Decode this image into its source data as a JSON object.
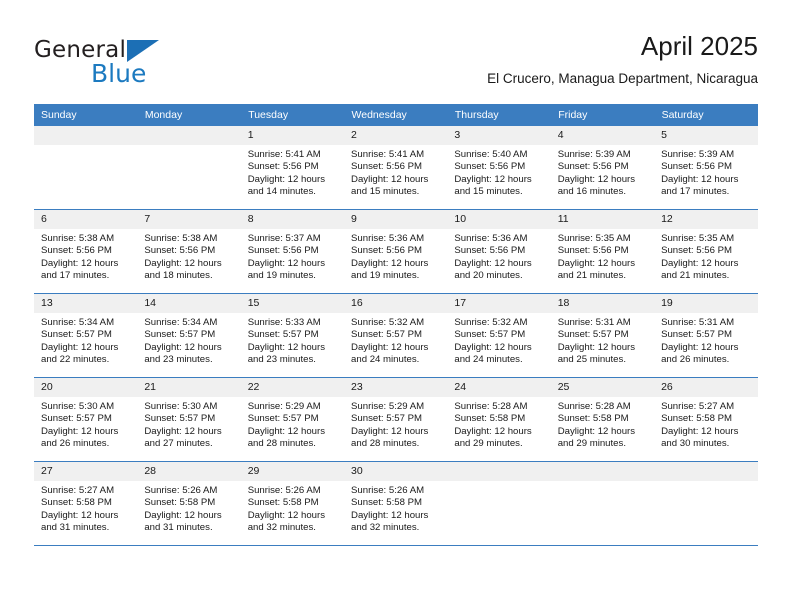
{
  "logo": {
    "word_top": "General",
    "word_bottom": "Blue",
    "triangle_color": "#1c6fb5",
    "blue_text_color": "#1c7ac0"
  },
  "header": {
    "month_title": "April 2025",
    "location": "El Crucero, Managua Department, Nicaragua"
  },
  "theme": {
    "header_blue": "#3b7dc0",
    "daynum_gray": "#f0f0f0"
  },
  "calendar": {
    "weekday_headers": [
      "Sunday",
      "Monday",
      "Tuesday",
      "Wednesday",
      "Thursday",
      "Friday",
      "Saturday"
    ],
    "weeks": [
      [
        {
          "day": "",
          "sunrise": "",
          "sunset": "",
          "daylight_line1": "",
          "daylight_line2": "",
          "empty": true
        },
        {
          "day": "",
          "sunrise": "",
          "sunset": "",
          "daylight_line1": "",
          "daylight_line2": "",
          "empty": true
        },
        {
          "day": "1",
          "sunrise": "Sunrise: 5:41 AM",
          "sunset": "Sunset: 5:56 PM",
          "daylight_line1": "Daylight: 12 hours",
          "daylight_line2": "and 14 minutes.",
          "empty": false
        },
        {
          "day": "2",
          "sunrise": "Sunrise: 5:41 AM",
          "sunset": "Sunset: 5:56 PM",
          "daylight_line1": "Daylight: 12 hours",
          "daylight_line2": "and 15 minutes.",
          "empty": false
        },
        {
          "day": "3",
          "sunrise": "Sunrise: 5:40 AM",
          "sunset": "Sunset: 5:56 PM",
          "daylight_line1": "Daylight: 12 hours",
          "daylight_line2": "and 15 minutes.",
          "empty": false
        },
        {
          "day": "4",
          "sunrise": "Sunrise: 5:39 AM",
          "sunset": "Sunset: 5:56 PM",
          "daylight_line1": "Daylight: 12 hours",
          "daylight_line2": "and 16 minutes.",
          "empty": false
        },
        {
          "day": "5",
          "sunrise": "Sunrise: 5:39 AM",
          "sunset": "Sunset: 5:56 PM",
          "daylight_line1": "Daylight: 12 hours",
          "daylight_line2": "and 17 minutes.",
          "empty": false
        }
      ],
      [
        {
          "day": "6",
          "sunrise": "Sunrise: 5:38 AM",
          "sunset": "Sunset: 5:56 PM",
          "daylight_line1": "Daylight: 12 hours",
          "daylight_line2": "and 17 minutes.",
          "empty": false
        },
        {
          "day": "7",
          "sunrise": "Sunrise: 5:38 AM",
          "sunset": "Sunset: 5:56 PM",
          "daylight_line1": "Daylight: 12 hours",
          "daylight_line2": "and 18 minutes.",
          "empty": false
        },
        {
          "day": "8",
          "sunrise": "Sunrise: 5:37 AM",
          "sunset": "Sunset: 5:56 PM",
          "daylight_line1": "Daylight: 12 hours",
          "daylight_line2": "and 19 minutes.",
          "empty": false
        },
        {
          "day": "9",
          "sunrise": "Sunrise: 5:36 AM",
          "sunset": "Sunset: 5:56 PM",
          "daylight_line1": "Daylight: 12 hours",
          "daylight_line2": "and 19 minutes.",
          "empty": false
        },
        {
          "day": "10",
          "sunrise": "Sunrise: 5:36 AM",
          "sunset": "Sunset: 5:56 PM",
          "daylight_line1": "Daylight: 12 hours",
          "daylight_line2": "and 20 minutes.",
          "empty": false
        },
        {
          "day": "11",
          "sunrise": "Sunrise: 5:35 AM",
          "sunset": "Sunset: 5:56 PM",
          "daylight_line1": "Daylight: 12 hours",
          "daylight_line2": "and 21 minutes.",
          "empty": false
        },
        {
          "day": "12",
          "sunrise": "Sunrise: 5:35 AM",
          "sunset": "Sunset: 5:56 PM",
          "daylight_line1": "Daylight: 12 hours",
          "daylight_line2": "and 21 minutes.",
          "empty": false
        }
      ],
      [
        {
          "day": "13",
          "sunrise": "Sunrise: 5:34 AM",
          "sunset": "Sunset: 5:57 PM",
          "daylight_line1": "Daylight: 12 hours",
          "daylight_line2": "and 22 minutes.",
          "empty": false
        },
        {
          "day": "14",
          "sunrise": "Sunrise: 5:34 AM",
          "sunset": "Sunset: 5:57 PM",
          "daylight_line1": "Daylight: 12 hours",
          "daylight_line2": "and 23 minutes.",
          "empty": false
        },
        {
          "day": "15",
          "sunrise": "Sunrise: 5:33 AM",
          "sunset": "Sunset: 5:57 PM",
          "daylight_line1": "Daylight: 12 hours",
          "daylight_line2": "and 23 minutes.",
          "empty": false
        },
        {
          "day": "16",
          "sunrise": "Sunrise: 5:32 AM",
          "sunset": "Sunset: 5:57 PM",
          "daylight_line1": "Daylight: 12 hours",
          "daylight_line2": "and 24 minutes.",
          "empty": false
        },
        {
          "day": "17",
          "sunrise": "Sunrise: 5:32 AM",
          "sunset": "Sunset: 5:57 PM",
          "daylight_line1": "Daylight: 12 hours",
          "daylight_line2": "and 24 minutes.",
          "empty": false
        },
        {
          "day": "18",
          "sunrise": "Sunrise: 5:31 AM",
          "sunset": "Sunset: 5:57 PM",
          "daylight_line1": "Daylight: 12 hours",
          "daylight_line2": "and 25 minutes.",
          "empty": false
        },
        {
          "day": "19",
          "sunrise": "Sunrise: 5:31 AM",
          "sunset": "Sunset: 5:57 PM",
          "daylight_line1": "Daylight: 12 hours",
          "daylight_line2": "and 26 minutes.",
          "empty": false
        }
      ],
      [
        {
          "day": "20",
          "sunrise": "Sunrise: 5:30 AM",
          "sunset": "Sunset: 5:57 PM",
          "daylight_line1": "Daylight: 12 hours",
          "daylight_line2": "and 26 minutes.",
          "empty": false
        },
        {
          "day": "21",
          "sunrise": "Sunrise: 5:30 AM",
          "sunset": "Sunset: 5:57 PM",
          "daylight_line1": "Daylight: 12 hours",
          "daylight_line2": "and 27 minutes.",
          "empty": false
        },
        {
          "day": "22",
          "sunrise": "Sunrise: 5:29 AM",
          "sunset": "Sunset: 5:57 PM",
          "daylight_line1": "Daylight: 12 hours",
          "daylight_line2": "and 28 minutes.",
          "empty": false
        },
        {
          "day": "23",
          "sunrise": "Sunrise: 5:29 AM",
          "sunset": "Sunset: 5:57 PM",
          "daylight_line1": "Daylight: 12 hours",
          "daylight_line2": "and 28 minutes.",
          "empty": false
        },
        {
          "day": "24",
          "sunrise": "Sunrise: 5:28 AM",
          "sunset": "Sunset: 5:58 PM",
          "daylight_line1": "Daylight: 12 hours",
          "daylight_line2": "and 29 minutes.",
          "empty": false
        },
        {
          "day": "25",
          "sunrise": "Sunrise: 5:28 AM",
          "sunset": "Sunset: 5:58 PM",
          "daylight_line1": "Daylight: 12 hours",
          "daylight_line2": "and 29 minutes.",
          "empty": false
        },
        {
          "day": "26",
          "sunrise": "Sunrise: 5:27 AM",
          "sunset": "Sunset: 5:58 PM",
          "daylight_line1": "Daylight: 12 hours",
          "daylight_line2": "and 30 minutes.",
          "empty": false
        }
      ],
      [
        {
          "day": "27",
          "sunrise": "Sunrise: 5:27 AM",
          "sunset": "Sunset: 5:58 PM",
          "daylight_line1": "Daylight: 12 hours",
          "daylight_line2": "and 31 minutes.",
          "empty": false
        },
        {
          "day": "28",
          "sunrise": "Sunrise: 5:26 AM",
          "sunset": "Sunset: 5:58 PM",
          "daylight_line1": "Daylight: 12 hours",
          "daylight_line2": "and 31 minutes.",
          "empty": false
        },
        {
          "day": "29",
          "sunrise": "Sunrise: 5:26 AM",
          "sunset": "Sunset: 5:58 PM",
          "daylight_line1": "Daylight: 12 hours",
          "daylight_line2": "and 32 minutes.",
          "empty": false
        },
        {
          "day": "30",
          "sunrise": "Sunrise: 5:26 AM",
          "sunset": "Sunset: 5:58 PM",
          "daylight_line1": "Daylight: 12 hours",
          "daylight_line2": "and 32 minutes.",
          "empty": false
        },
        {
          "day": "",
          "sunrise": "",
          "sunset": "",
          "daylight_line1": "",
          "daylight_line2": "",
          "empty": true
        },
        {
          "day": "",
          "sunrise": "",
          "sunset": "",
          "daylight_line1": "",
          "daylight_line2": "",
          "empty": true
        },
        {
          "day": "",
          "sunrise": "",
          "sunset": "",
          "daylight_line1": "",
          "daylight_line2": "",
          "empty": true
        }
      ]
    ]
  }
}
